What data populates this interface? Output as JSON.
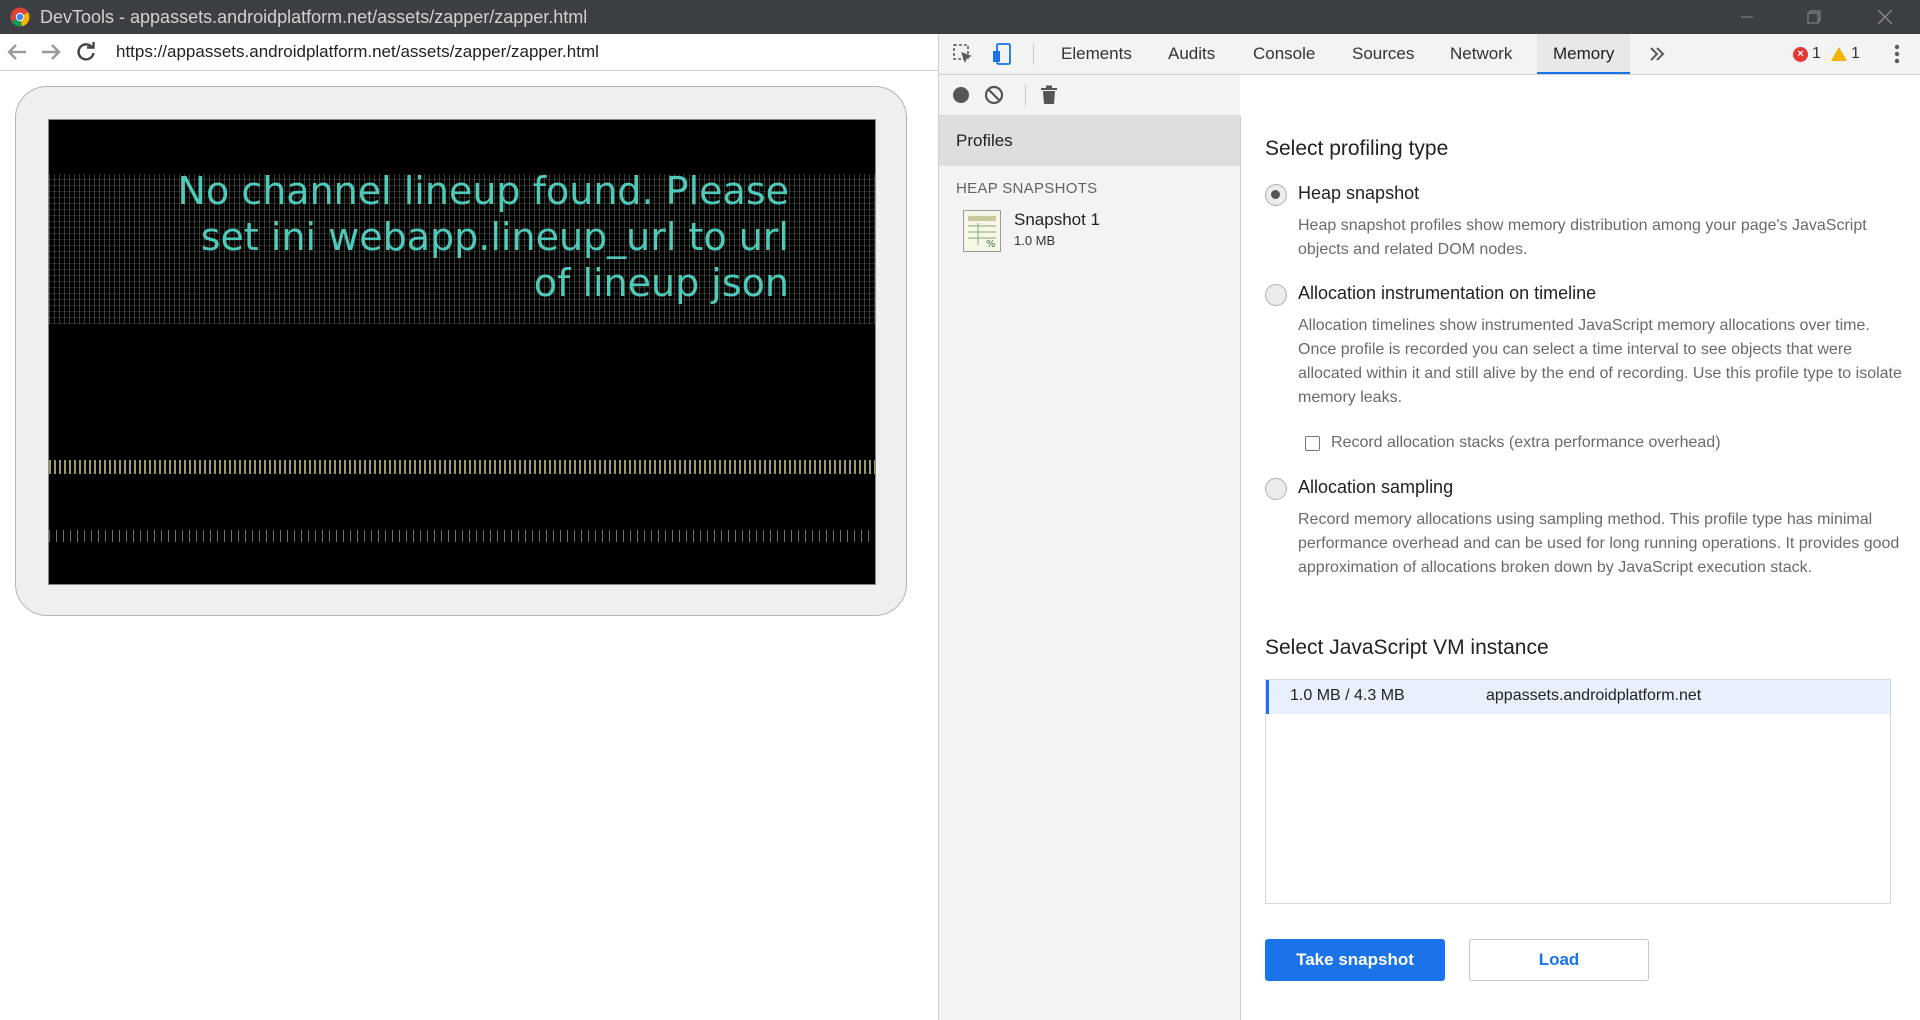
{
  "window": {
    "title": "DevTools - appassets.androidplatform.net/assets/zapper/zapper.html"
  },
  "browser": {
    "url": "https://appassets.androidplatform.net/assets/zapper/zapper.html",
    "screen_message": "No channel lineup found. Please set ini webapp.lineup_url to url of lineup json"
  },
  "devtools": {
    "tabs": [
      {
        "label": "Elements"
      },
      {
        "label": "Audits"
      },
      {
        "label": "Console"
      },
      {
        "label": "Sources"
      },
      {
        "label": "Network"
      },
      {
        "label": "Memory"
      }
    ],
    "active_tab": "Memory",
    "error_count": "1",
    "warning_count": "1",
    "sidebar": {
      "profiles_label": "Profiles",
      "heap_heading": "HEAP SNAPSHOTS",
      "snapshot": {
        "title": "Snapshot 1",
        "size": "1.0 MB"
      }
    },
    "main": {
      "profiling_title": "Select profiling type",
      "options": [
        {
          "label": "Heap snapshot",
          "checked": true,
          "desc": "Heap snapshot profiles show memory distribution among your page's JavaScript objects and related DOM nodes."
        },
        {
          "label": "Allocation instrumentation on timeline",
          "checked": false,
          "desc": "Allocation timelines show instrumented JavaScript memory allocations over time. Once profile is recorded you can select a time interval to see objects that were allocated within it and still alive by the end of recording. Use this profile type to isolate memory leaks."
        },
        {
          "label": "Allocation sampling",
          "checked": false,
          "desc": "Record memory allocations using sampling method. This profile type has minimal performance overhead and can be used for long running operations. It provides good approximation of allocations broken down by JavaScript execution stack."
        }
      ],
      "record_stacks_label": "Record allocation stacks (extra performance overhead)",
      "vm_title": "Select JavaScript VM instance",
      "vm_instance": {
        "size": "1.0 MB / 4.3 MB",
        "host": "appassets.androidplatform.net"
      },
      "take_snapshot_label": "Take snapshot",
      "load_label": "Load"
    }
  },
  "colors": {
    "accent": "#1a73e8",
    "screen_text": "#4fc9b8",
    "error": "#e53935",
    "warning": "#f4b400"
  }
}
